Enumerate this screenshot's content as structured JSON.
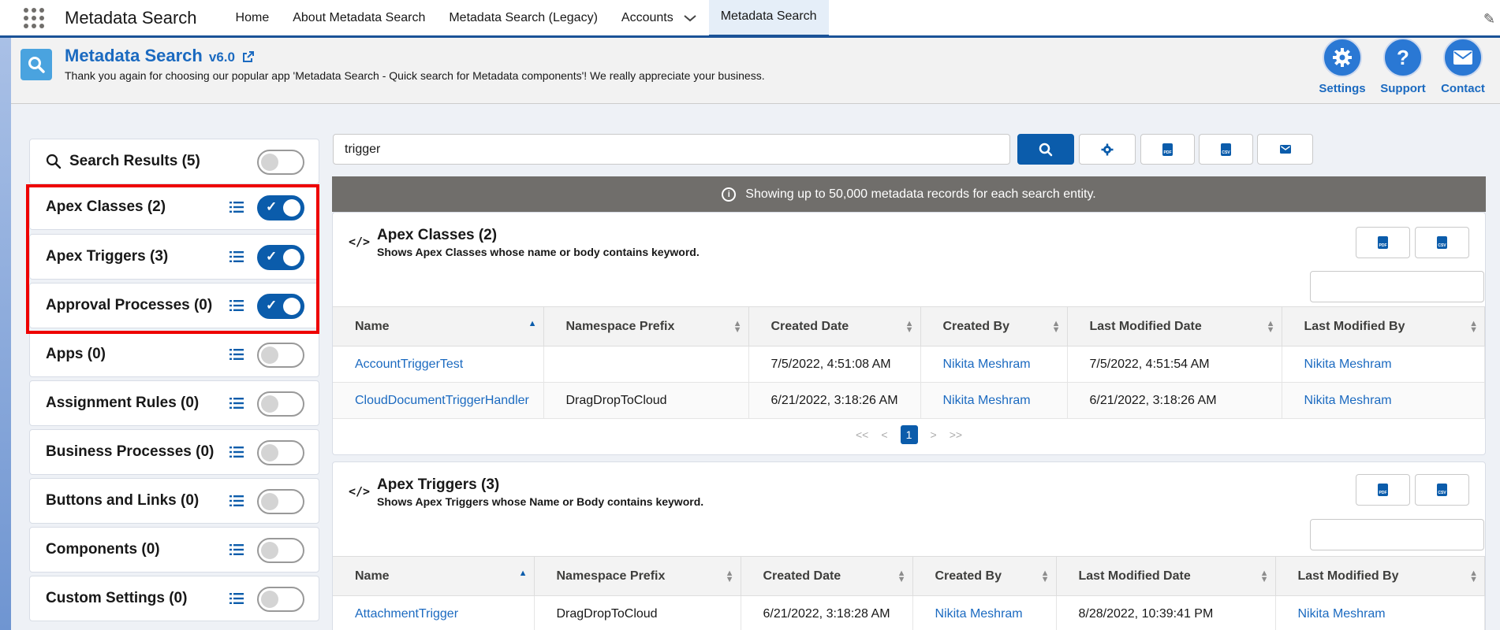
{
  "topnav": {
    "app_name": "Metadata Search",
    "tabs": [
      {
        "label": "Home"
      },
      {
        "label": "About Metadata Search"
      },
      {
        "label": "Metadata Search (Legacy)"
      },
      {
        "label": "Accounts"
      },
      {
        "label": "Metadata Search"
      }
    ]
  },
  "header": {
    "title": "Metadata Search",
    "version": "v6.0",
    "subtitle": "Thank you again for choosing our popular app 'Metadata Search - Quick search for Metadata components'! We really appreciate your business.",
    "buttons": [
      {
        "label": "Settings",
        "icon": "gear-icon"
      },
      {
        "label": "Support",
        "icon": "question-icon"
      },
      {
        "label": "Contact",
        "icon": "mail-icon"
      }
    ]
  },
  "sidebar": {
    "items": [
      {
        "label": "Search Results (5)",
        "enabled": false
      },
      {
        "label": "Apex Classes (2)",
        "enabled": true
      },
      {
        "label": "Apex Triggers (3)",
        "enabled": true
      },
      {
        "label": "Approval Processes (0)",
        "enabled": true
      },
      {
        "label": "Apps (0)",
        "enabled": false
      },
      {
        "label": "Assignment Rules (0)",
        "enabled": false
      },
      {
        "label": "Business Processes (0)",
        "enabled": false
      },
      {
        "label": "Buttons and Links (0)",
        "enabled": false
      },
      {
        "label": "Components (0)",
        "enabled": false
      },
      {
        "label": "Custom Settings (0)",
        "enabled": false
      }
    ]
  },
  "search": {
    "value": "trigger",
    "file_labels": {
      "pdf": "PDF",
      "csv": "CSV"
    }
  },
  "banner": {
    "text": "Showing up to 50,000 metadata records for each search entity."
  },
  "columns": [
    "Name",
    "Namespace Prefix",
    "Created Date",
    "Created By",
    "Last Modified Date",
    "Last Modified By"
  ],
  "cards": [
    {
      "title": "Apex Classes (2)",
      "description": "Shows Apex Classes whose name or body contains keyword.",
      "rows": [
        [
          "AccountTriggerTest",
          "",
          "7/5/2022, 4:51:08 AM",
          "Nikita Meshram",
          "7/5/2022, 4:51:54 AM",
          "Nikita Meshram"
        ],
        [
          "CloudDocumentTriggerHandler",
          "DragDropToCloud",
          "6/21/2022, 3:18:26 AM",
          "Nikita Meshram",
          "6/21/2022, 3:18:26 AM",
          "Nikita Meshram"
        ]
      ],
      "pager": {
        "first": "<<",
        "prev": "<",
        "current": "1",
        "next": ">",
        "last": ">>"
      }
    },
    {
      "title": "Apex Triggers (3)",
      "description": "Shows Apex Triggers whose Name or Body contains keyword.",
      "rows": [
        [
          "AttachmentTrigger",
          "DragDropToCloud",
          "6/21/2022, 3:18:28 AM",
          "Nikita Meshram",
          "8/28/2022, 10:39:41 PM",
          "Nikita Meshram"
        ]
      ]
    }
  ],
  "colors": {
    "brand": "#0b5cab",
    "link": "#1b6ac0",
    "highlight": "#ee0000",
    "banner": "#706e6b"
  }
}
